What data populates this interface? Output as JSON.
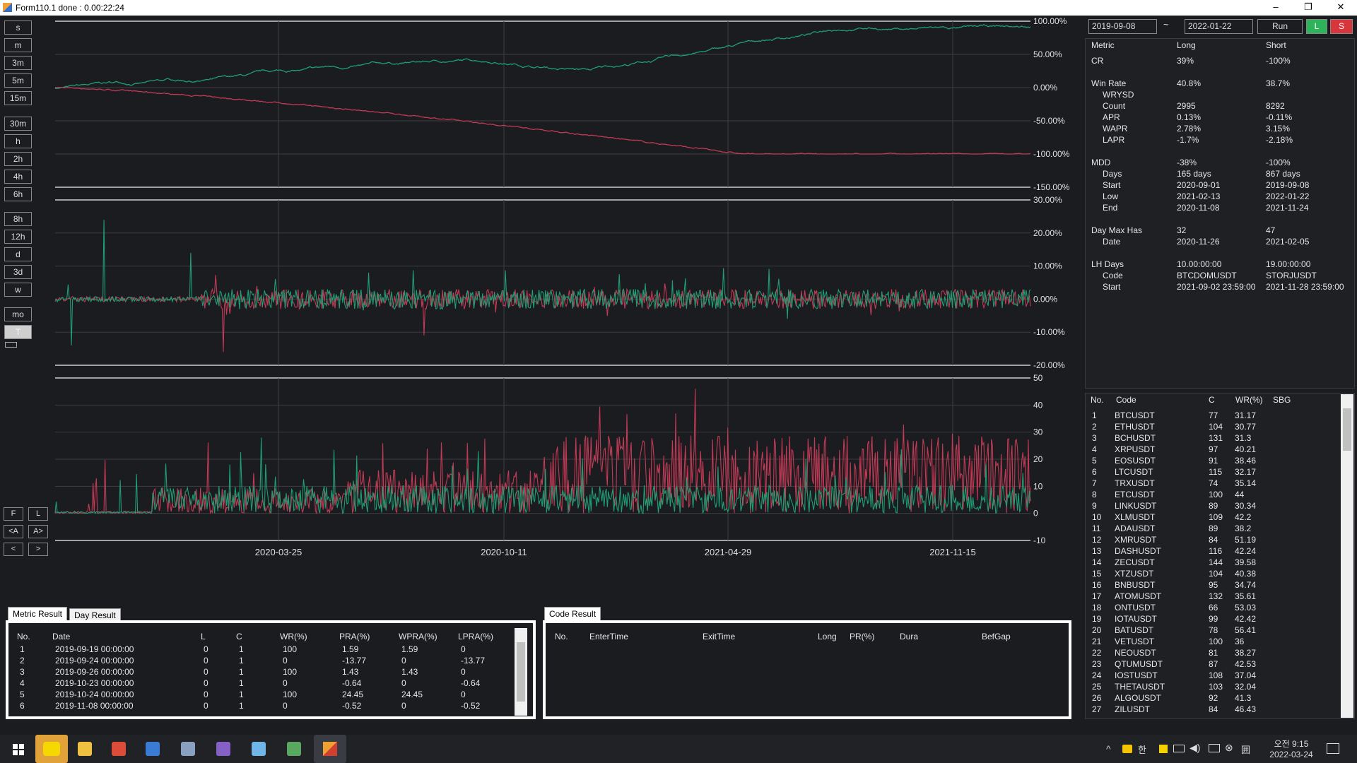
{
  "window": {
    "title": "Form110.1 done : 0.00:22:24",
    "min": "–",
    "restore": "❐",
    "close": "✕"
  },
  "timeframes": [
    "s",
    "m",
    "3m",
    "5m",
    "15m",
    "30m",
    "h",
    "2h",
    "4h",
    "6h",
    "8h",
    "12h",
    "d",
    "3d",
    "w",
    "mo",
    "T"
  ],
  "nav": {
    "first": "F",
    "last": "L",
    "prev_a": "<A",
    "next_a": "A>",
    "prev": "<",
    "next": ">"
  },
  "controls": {
    "start_date": "2019-09-08",
    "tilde": "~",
    "end_date": "2022-01-22",
    "run": "Run",
    "long": "L",
    "short": "S"
  },
  "colors": {
    "long": "#1f9e74",
    "short": "#c23a55",
    "grid": "#3c3d42",
    "accent_green": "#2fb35a",
    "accent_red": "#d8363d"
  },
  "chart_data": [
    {
      "type": "line",
      "title": "",
      "series": [
        {
          "name": "Long",
          "summary": "cumulative return, rises to ~90% by 2021-11"
        },
        {
          "name": "Short",
          "summary": "cumulative return, declines to -100%"
        }
      ],
      "ylim": [
        -150,
        100
      ],
      "yticks": [
        "100.00%",
        "50.00%",
        "0.00%",
        "-50.00%",
        "-100.00%",
        "-150.00%"
      ]
    },
    {
      "type": "line",
      "title": "",
      "series": [
        {
          "name": "Long"
        },
        {
          "name": "Short"
        }
      ],
      "ylim": [
        -20,
        30
      ],
      "yticks": [
        "30.00%",
        "20.00%",
        "10.00%",
        "0.00%",
        "-10.00%",
        "-20.00%"
      ]
    },
    {
      "type": "line",
      "title": "",
      "series": [
        {
          "name": "Long"
        },
        {
          "name": "Short"
        }
      ],
      "ylim": [
        -10,
        50
      ],
      "yticks": [
        "50",
        "40",
        "30",
        "20",
        "10",
        "0",
        "-10"
      ]
    }
  ],
  "xticks": [
    "2020-03-25",
    "2020-10-11",
    "2021-04-29",
    "2021-11-15"
  ],
  "metrics": {
    "header": [
      "Metric",
      "Long",
      "Short"
    ],
    "rows": [
      {
        "k": "CR",
        "l": "39%",
        "s": "-100%",
        "indent": 0
      },
      {
        "k": "Win Rate",
        "l": "40.8%",
        "s": "38.7%",
        "indent": 0,
        "gap": true
      },
      {
        "k": "WRYSD",
        "l": "",
        "s": "",
        "indent": 1
      },
      {
        "k": "Count",
        "l": "2995",
        "s": "8292",
        "indent": 1
      },
      {
        "k": "APR",
        "l": "0.13%",
        "s": "-0.11%",
        "indent": 1
      },
      {
        "k": "WAPR",
        "l": "2.78%",
        "s": "3.15%",
        "indent": 1
      },
      {
        "k": "LAPR",
        "l": "-1.7%",
        "s": "-2.18%",
        "indent": 1
      },
      {
        "k": "MDD",
        "l": "-38%",
        "s": "-100%",
        "indent": 0,
        "gap": true
      },
      {
        "k": "Days",
        "l": "165 days",
        "s": "867 days",
        "indent": 1
      },
      {
        "k": "Start",
        "l": "2020-09-01",
        "s": "2019-09-08",
        "indent": 1
      },
      {
        "k": "Low",
        "l": "2021-02-13",
        "s": "2022-01-22",
        "indent": 1
      },
      {
        "k": "End",
        "l": "2020-11-08",
        "s": "2021-11-24",
        "indent": 1
      },
      {
        "k": "Day Max Has",
        "l": "32",
        "s": "47",
        "indent": 0,
        "gap": true
      },
      {
        "k": "Date",
        "l": "2020-11-26",
        "s": "2021-02-05",
        "indent": 1
      },
      {
        "k": "LH Days",
        "l": "10.00:00:00",
        "s": "19.00:00:00",
        "indent": 0,
        "gap": true
      },
      {
        "k": "Code",
        "l": "BTCDOMUSDT",
        "s": "STORJUSDT",
        "indent": 1
      },
      {
        "k": "Start",
        "l": "2021-09-02 23:59:00",
        "s": "2021-11-28 23:59:00",
        "indent": 1
      }
    ]
  },
  "codes": {
    "header": [
      "No.",
      "Code",
      "C",
      "WR(%)",
      "SBG"
    ],
    "rows": [
      [
        "1",
        "BTCUSDT",
        "77",
        "31.17"
      ],
      [
        "2",
        "ETHUSDT",
        "104",
        "30.77"
      ],
      [
        "3",
        "BCHUSDT",
        "131",
        "31.3"
      ],
      [
        "4",
        "XRPUSDT",
        "97",
        "40.21"
      ],
      [
        "5",
        "EOSUSDT",
        "91",
        "38.46"
      ],
      [
        "6",
        "LTCUSDT",
        "115",
        "32.17"
      ],
      [
        "7",
        "TRXUSDT",
        "74",
        "35.14"
      ],
      [
        "8",
        "ETCUSDT",
        "100",
        "44"
      ],
      [
        "9",
        "LINKUSDT",
        "89",
        "30.34"
      ],
      [
        "10",
        "XLMUSDT",
        "109",
        "42.2"
      ],
      [
        "11",
        "ADAUSDT",
        "89",
        "38.2"
      ],
      [
        "12",
        "XMRUSDT",
        "84",
        "51.19"
      ],
      [
        "13",
        "DASHUSDT",
        "116",
        "42.24"
      ],
      [
        "14",
        "ZECUSDT",
        "144",
        "39.58"
      ],
      [
        "15",
        "XTZUSDT",
        "104",
        "40.38"
      ],
      [
        "16",
        "BNBUSDT",
        "95",
        "34.74"
      ],
      [
        "17",
        "ATOMUSDT",
        "132",
        "35.61"
      ],
      [
        "18",
        "ONTUSDT",
        "66",
        "53.03"
      ],
      [
        "19",
        "IOTAUSDT",
        "99",
        "42.42"
      ],
      [
        "20",
        "BATUSDT",
        "78",
        "56.41"
      ],
      [
        "21",
        "VETUSDT",
        "100",
        "36"
      ],
      [
        "22",
        "NEOUSDT",
        "81",
        "38.27"
      ],
      [
        "23",
        "QTUMUSDT",
        "87",
        "42.53"
      ],
      [
        "24",
        "IOSTUSDT",
        "108",
        "37.04"
      ],
      [
        "25",
        "THETAUSDT",
        "103",
        "32.04"
      ],
      [
        "26",
        "ALGOUSDT",
        "92",
        "41.3"
      ],
      [
        "27",
        "ZILUSDT",
        "84",
        "46.43"
      ]
    ]
  },
  "metric_result": {
    "tabs": [
      "Metric Result",
      "Day Result"
    ],
    "header": [
      "No.",
      "Date",
      "L",
      "C",
      "WR(%)",
      "PRA(%)",
      "WPRA(%)",
      "LPRA(%)"
    ],
    "rows": [
      [
        "1",
        "2019-09-19 00:00:00",
        "0",
        "1",
        "100",
        "1.59",
        "1.59",
        "0"
      ],
      [
        "2",
        "2019-09-24 00:00:00",
        "0",
        "1",
        "0",
        "-13.77",
        "0",
        "-13.77"
      ],
      [
        "3",
        "2019-09-26 00:00:00",
        "0",
        "1",
        "100",
        "1.43",
        "1.43",
        "0"
      ],
      [
        "4",
        "2019-10-23 00:00:00",
        "0",
        "1",
        "0",
        "-0.64",
        "0",
        "-0.64"
      ],
      [
        "5",
        "2019-10-24 00:00:00",
        "0",
        "1",
        "100",
        "24.45",
        "24.45",
        "0"
      ],
      [
        "6",
        "2019-11-08 00:00:00",
        "0",
        "1",
        "0",
        "-0.52",
        "0",
        "-0.52"
      ]
    ]
  },
  "code_result": {
    "tab": "Code Result",
    "header": [
      "No.",
      "EnterTime",
      "ExitTime",
      "Long",
      "PR(%)",
      "Dura",
      "BefGap"
    ]
  },
  "tray": {
    "time": "오전 9:15",
    "date": "2022-03-24",
    "ime": "한"
  },
  "taskbar_icons": [
    "windows-start-icon",
    "kakaotalk-icon",
    "file-explorer-icon",
    "chrome-icon",
    "remote-desktop-icon",
    "computer-icon",
    "visual-studio-icon",
    "notepad-icon",
    "app-icon",
    "form-app-icon"
  ]
}
